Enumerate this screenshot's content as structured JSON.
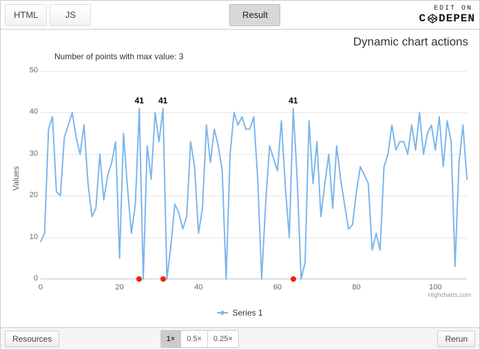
{
  "topbar": {
    "tabs": {
      "html": "HTML",
      "js": "JS",
      "result": "Result"
    },
    "edit_on": "EDIT ON",
    "brand": "C   DEPEN"
  },
  "chart": {
    "title": "Dynamic chart actions",
    "subtitle": "Number of points with max value: 3",
    "y_axis_title": "Values",
    "legend": "Series 1",
    "credits": "Highcharts.com",
    "y_ticks": [
      "0",
      "10",
      "20",
      "30",
      "40",
      "50"
    ],
    "x_ticks": [
      "0",
      "20",
      "40",
      "60",
      "80",
      "100"
    ],
    "max_labels": [
      {
        "x": 25,
        "text": "41"
      },
      {
        "x": 31,
        "text": "41"
      },
      {
        "x": 64,
        "text": "41"
      }
    ],
    "red_dots_x": [
      25,
      31,
      64
    ]
  },
  "chart_data": {
    "type": "line",
    "title": "Dynamic chart actions",
    "xlabel": "",
    "ylabel": "Values",
    "ylim": [
      0,
      50
    ],
    "xlim": [
      0,
      108
    ],
    "series": [
      {
        "name": "Series 1",
        "values": [
          9,
          11,
          36,
          39,
          21,
          20,
          34,
          37,
          40,
          34,
          30,
          37,
          23,
          15,
          17,
          30,
          19,
          25,
          28,
          33,
          5,
          35,
          22,
          11,
          18,
          41,
          0,
          32,
          24,
          40,
          33,
          41,
          0,
          8,
          18,
          16,
          12,
          15,
          33,
          27,
          11,
          17,
          37,
          28,
          36,
          32,
          26,
          0,
          30,
          40,
          37,
          39,
          36,
          36,
          39,
          24,
          0,
          18,
          32,
          29,
          26,
          38,
          22,
          10,
          41,
          24,
          0,
          4,
          38,
          23,
          33,
          15,
          23,
          30,
          17,
          32,
          24,
          18,
          12,
          13,
          21,
          27,
          25,
          23,
          7,
          11,
          7,
          27,
          30,
          37,
          31,
          33,
          33,
          30,
          37,
          31,
          40,
          30,
          35,
          37,
          31,
          39,
          27,
          38,
          33,
          3,
          28,
          37,
          24
        ]
      }
    ],
    "annotations": [
      {
        "x": 25,
        "y": 41,
        "text": "41"
      },
      {
        "x": 31,
        "y": 41,
        "text": "41"
      },
      {
        "x": 64,
        "y": 41,
        "text": "41"
      }
    ]
  },
  "bottombar": {
    "resources": "Resources",
    "zoom": {
      "x1": "1×",
      "x05": "0.5×",
      "x025": "0.25×"
    },
    "rerun": "Rerun"
  }
}
